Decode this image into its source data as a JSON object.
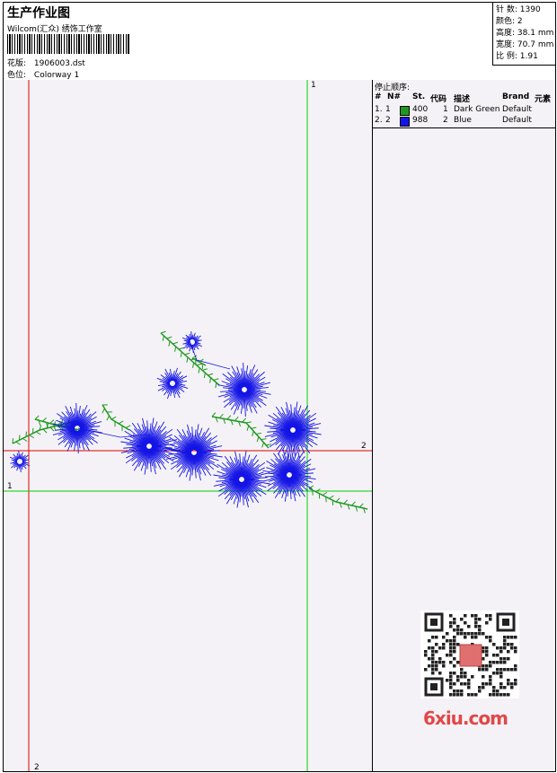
{
  "header": {
    "title": "生产作业图",
    "subtitle": "Wilcom(汇众) 绣饰工作室",
    "design_label": "花版:",
    "design_value": "1906003.dst",
    "colorway_label": "色位:",
    "colorway_value": "Colorway 1"
  },
  "stats": [
    {
      "label": "针 数:",
      "value": "1390"
    },
    {
      "label": "颜色:",
      "value": "2"
    },
    {
      "label": "高度:",
      "value": "38.1 mm"
    },
    {
      "label": "宽度:",
      "value": "70.7 mm"
    },
    {
      "label": "比 例:",
      "value": "1.91"
    }
  ],
  "stop_sequence": {
    "title": "停止顺序:",
    "columns": [
      "#",
      "N#",
      "St.",
      "代码",
      "描述",
      "Brand",
      "元素"
    ],
    "rows": [
      {
        "idx": "1.",
        "n": "1",
        "color": "#1e9a1e",
        "st": "400",
        "code": "1",
        "desc": "Dark Green",
        "brand": "Default"
      },
      {
        "idx": "2.",
        "n": "2",
        "color": "#1414e6",
        "st": "988",
        "code": "2",
        "desc": "Blue",
        "brand": "Default"
      }
    ]
  },
  "guides": {
    "red_vertical_label": "2",
    "red_horizontal_label": "2",
    "green_vertical_label": "1",
    "green_horizontal_label": "1"
  },
  "colors": {
    "green": "#1e9a1e",
    "blue": "#1414e6",
    "red_guide": "#e00000",
    "green_guide": "#00d000"
  },
  "watermark": {
    "text": "6xiu.com"
  }
}
